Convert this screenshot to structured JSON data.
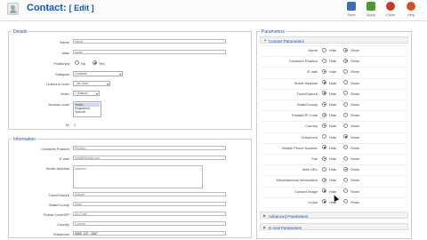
{
  "header": {
    "title": "Contact:",
    "edit": "[ Edit ]",
    "buttons": [
      {
        "label": "Save",
        "color": "#3b6fb8"
      },
      {
        "label": "Apply",
        "color": "#4c9a35"
      },
      {
        "label": "Close",
        "color": "#c23a2b"
      },
      {
        "label": "Help",
        "color": "#d0502c"
      }
    ]
  },
  "details": {
    "legend": "Details",
    "fields": {
      "name": {
        "label": "Name",
        "value": "Name"
      },
      "alias": {
        "label": "Alias",
        "value": "name"
      },
      "published": {
        "label": "Published",
        "no": "No",
        "yes": "Yes"
      },
      "category": {
        "label": "Category",
        "value": "Contacts"
      },
      "linked_user": {
        "label": "Linked to User",
        "value": "- No User -"
      },
      "order": {
        "label": "Order",
        "value": "1 (Name)"
      },
      "access": {
        "label": "Access Level",
        "options": [
          "Public",
          "Registered",
          "Special"
        ]
      },
      "id": {
        "label": "ID",
        "value": "1"
      }
    }
  },
  "information": {
    "legend": "Information",
    "fields": {
      "position": {
        "label": "Contact's Position",
        "value": "Position"
      },
      "email": {
        "label": "E-mail",
        "value": "email@email.com"
      },
      "address": {
        "label": "Street Address",
        "value": "Address"
      },
      "suburb": {
        "label": "Town/Suburb",
        "value": "Suburb"
      },
      "state": {
        "label": "State/County",
        "value": "State"
      },
      "postcode": {
        "label": "Postal Code/ZIP",
        "value": "Zip Code"
      },
      "country": {
        "label": "Country",
        "value": "Country"
      },
      "telephone": {
        "label": "Telephone",
        "value": "(888) 123 - 1587"
      }
    }
  },
  "parameters": {
    "legend": "Parameters",
    "contact_params_title": "Contact Parameters",
    "rows": [
      {
        "label": "Name",
        "left": "Hide",
        "right": "Show",
        "selected": "right"
      },
      {
        "label": "Contact's Position",
        "left": "Hide",
        "right": "Show",
        "selected": "right"
      },
      {
        "label": "E-mail",
        "left": "Hide",
        "right": "Show",
        "selected": "left"
      },
      {
        "label": "Street Address",
        "left": "Hide",
        "right": "Show",
        "selected": "left"
      },
      {
        "label": "Town/Suburb",
        "left": "Hide",
        "right": "Show",
        "selected": "left"
      },
      {
        "label": "State/County",
        "left": "Hide",
        "right": "Show",
        "selected": "left"
      },
      {
        "label": "Postal/ZIP Code",
        "left": "Hide",
        "right": "Show",
        "selected": "left"
      },
      {
        "label": "Country",
        "left": "Hide",
        "right": "Show",
        "selected": "left"
      },
      {
        "label": "Telephone",
        "left": "Hide",
        "right": "Show",
        "selected": "right"
      },
      {
        "label": "Mobile Phone Number",
        "left": "Hide",
        "right": "Show",
        "selected": "left"
      },
      {
        "label": "Fax",
        "left": "Hide",
        "right": "Show",
        "selected": "left"
      },
      {
        "label": "Web URL",
        "left": "Hide",
        "right": "Show",
        "selected": "right"
      },
      {
        "label": "Miscellaneous Information",
        "left": "Hide",
        "right": "Show",
        "selected": "left"
      },
      {
        "label": "Contact Image",
        "left": "Hide",
        "right": "Show",
        "selected": "left"
      },
      {
        "label": "vCard",
        "left": "Hide",
        "right": "Show",
        "selected": "left"
      }
    ],
    "advanced_title": "Advanced Parameters",
    "email_title": "E-mail Parameters"
  }
}
